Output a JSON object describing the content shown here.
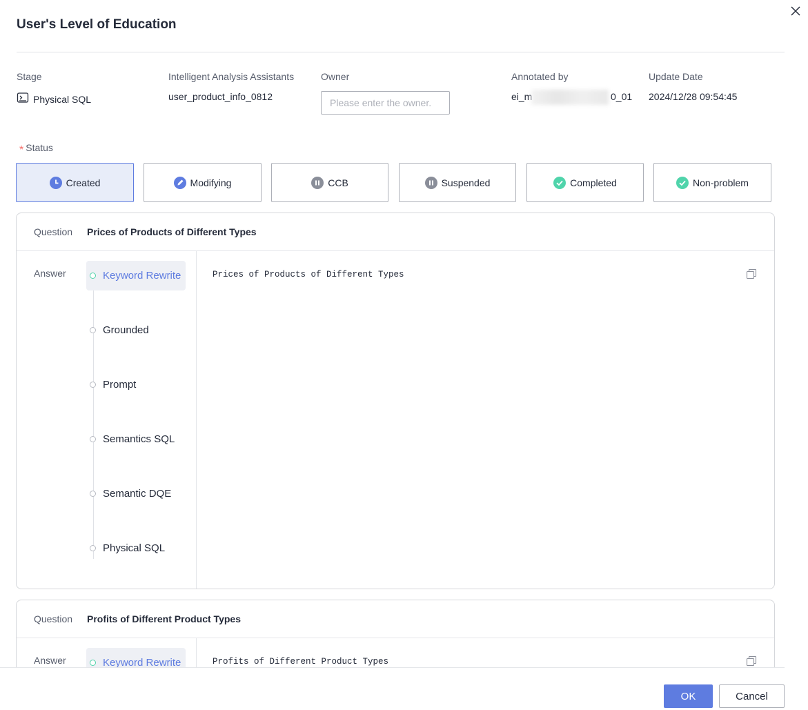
{
  "dialog": {
    "title": "User's Level of Education"
  },
  "meta": {
    "stage": {
      "label": "Stage",
      "value": "Physical SQL"
    },
    "assistant": {
      "label": "Intelligent Analysis Assistants",
      "value": "user_product_info_0812"
    },
    "owner": {
      "label": "Owner",
      "placeholder": "Please enter the owner.",
      "value": ""
    },
    "annotated_by": {
      "label": "Annotated by",
      "value_start": "ei_m",
      "value_end": "0_01"
    },
    "update_date": {
      "label": "Update Date",
      "value": "2024/12/28 09:54:45"
    }
  },
  "status": {
    "label": "Status",
    "required_mark": "*",
    "options": [
      {
        "label": "Created",
        "icon": "clock-icon",
        "color": "#5e7ce0",
        "active": true
      },
      {
        "label": "Modifying",
        "icon": "pencil-icon",
        "color": "#5e7ce0",
        "active": false
      },
      {
        "label": "CCB",
        "icon": "pause-icon",
        "color": "#8a8e99",
        "active": false
      },
      {
        "label": "Suspended",
        "icon": "pause-icon",
        "color": "#8a8e99",
        "active": false
      },
      {
        "label": "Completed",
        "icon": "check-icon",
        "color": "#50d4ab",
        "active": false
      },
      {
        "label": "Non-problem",
        "icon": "check-icon",
        "color": "#50d4ab",
        "active": false
      }
    ]
  },
  "qa": [
    {
      "question_label": "Question",
      "question": "Prices of Products of Different Types",
      "answer_label": "Answer",
      "steps": [
        "Keyword Rewrite",
        "Grounded",
        "Prompt",
        "Semantics SQL",
        "Semantic DQE",
        "Physical SQL"
      ],
      "active_step": "Keyword Rewrite",
      "answer_text": "Prices of Products of Different Types"
    },
    {
      "question_label": "Question",
      "question": "Profits of Different Product Types",
      "answer_label": "Answer",
      "steps": [
        "Keyword Rewrite"
      ],
      "active_step": "Keyword Rewrite",
      "answer_text": "Profits of Different Product Types"
    }
  ],
  "footer": {
    "ok_label": "OK",
    "cancel_label": "Cancel"
  },
  "colors": {
    "primary": "#5e7ce0",
    "success": "#50d4ab",
    "required": "#f66f6a"
  }
}
